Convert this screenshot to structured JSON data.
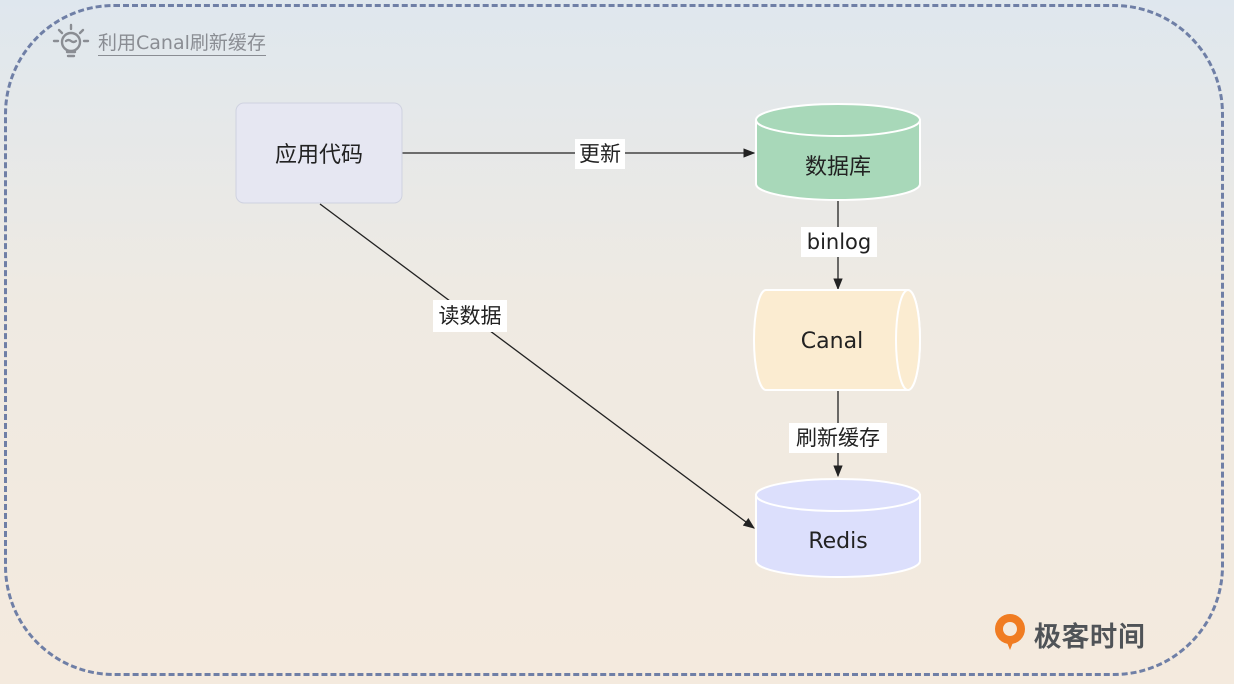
{
  "title": {
    "text": "利用Canal刷新缓存",
    "icon": "lightbulb-icon"
  },
  "nodes": {
    "app": {
      "label": "应用代码",
      "fill": "#e6e7f2"
    },
    "database": {
      "label": "数据库",
      "fill": "#a8d8b9"
    },
    "canal": {
      "label": "Canal",
      "fill": "#fbecd1"
    },
    "redis": {
      "label": "Redis",
      "fill": "#dcdffc"
    }
  },
  "edges": {
    "update": {
      "label": "更新"
    },
    "binlog": {
      "label": "binlog"
    },
    "refresh_cache": {
      "label": "刷新缓存"
    },
    "read_data": {
      "label": "读数据"
    }
  },
  "brand": {
    "text": "极客时间",
    "icon": "geektime-logo-icon",
    "color": "#f07c22"
  },
  "colors": {
    "frame_border": "#6f7fa6",
    "edge": "#222222"
  }
}
